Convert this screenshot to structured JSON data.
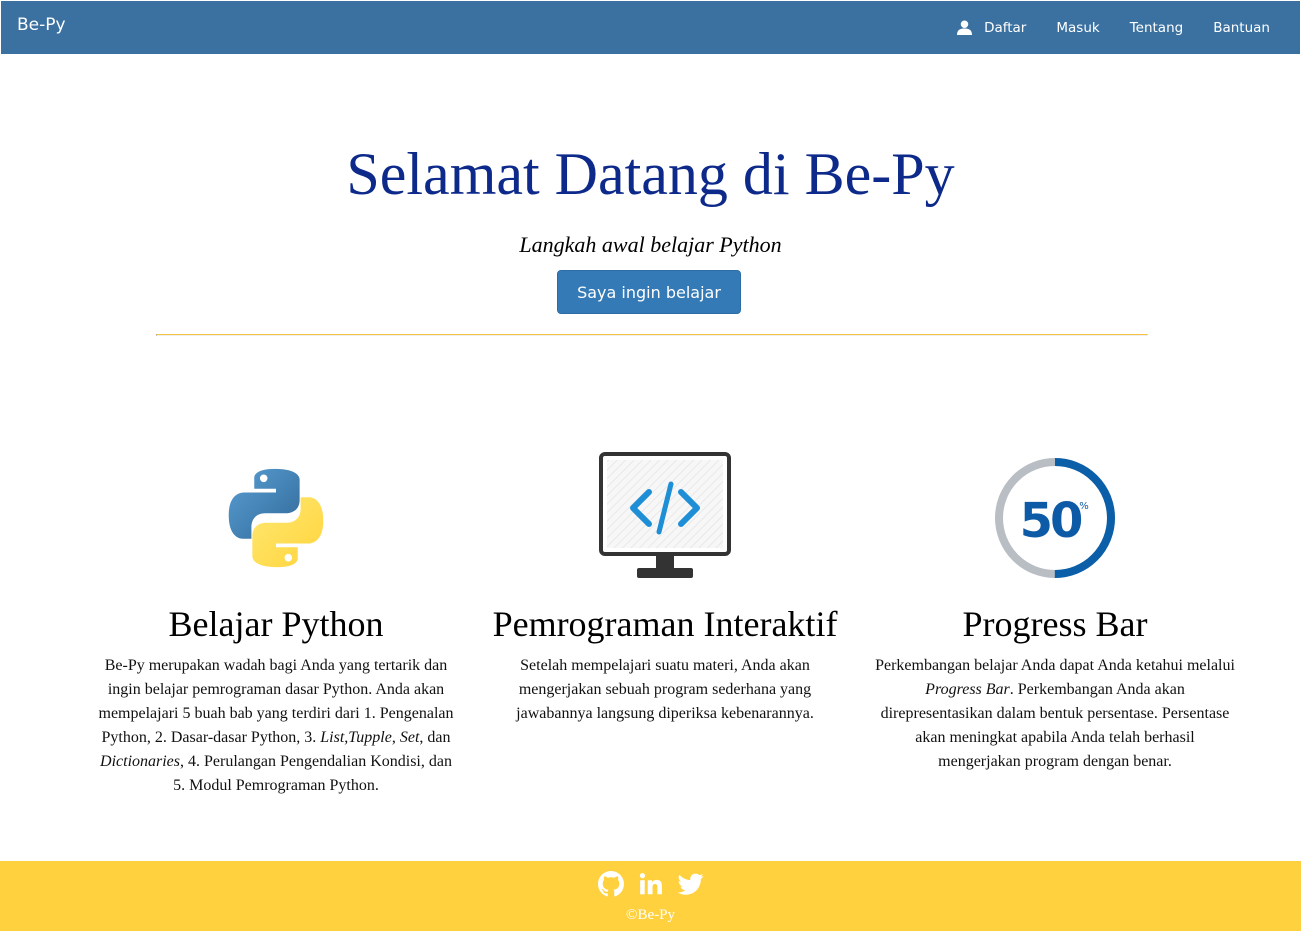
{
  "navbar": {
    "brand": "Be-Py",
    "items": [
      {
        "label": "Daftar",
        "icon": "user-icon"
      },
      {
        "label": "Masuk"
      },
      {
        "label": "Tentang"
      },
      {
        "label": "Bantuan"
      }
    ]
  },
  "hero": {
    "title": "Selamat Datang di Be-Py",
    "subtitle": "Langkah awal belajar Python",
    "cta_label": "Saya ingin belajar"
  },
  "features": [
    {
      "icon": "python-logo-icon",
      "title": "Belajar Python",
      "text_parts": [
        "Be-Py merupakan wadah bagi Anda yang tertarik dan ingin belajar pemrograman dasar Python. Anda akan mempelajari 5 buah bab yang terdiri dari 1. Pengenalan Python, 2. Dasar-dasar Python, 3. ",
        "List",
        ",",
        "Tupple",
        ", ",
        "Set",
        ", dan ",
        "Dictionaries",
        ", 4. Perulangan Pengendalian Kondisi, dan 5. Modul Pemrograman Python."
      ]
    },
    {
      "icon": "monitor-code-icon",
      "title": "Pemrograman Interaktif",
      "text": "Setelah mempelajari suatu materi, Anda akan mengerjakan sebuah program sederhana yang jawabannya langsung diperiksa kebenarannya."
    },
    {
      "icon": "progress-circle-icon",
      "title": "Progress Bar",
      "progress_value": "50",
      "progress_unit": "%",
      "progress_fraction": 0.5,
      "text_parts": [
        "Perkembangan belajar Anda dapat Anda ketahui melalui ",
        "Progress Bar",
        ". Perkembangan Anda akan direpresentasikan dalam bentuk persentase. Persentase akan meningkat apabila Anda telah berhasil mengerjakan program dengan benar."
      ]
    }
  ],
  "footer": {
    "social": [
      "github-icon",
      "linkedin-icon",
      "twitter-icon"
    ],
    "copyright": "©Be-Py"
  },
  "colors": {
    "navbar": "#3a71a1",
    "title": "#0d2a8a",
    "button": "#337ab7",
    "footer": "#ffd13f",
    "rule": "#f5c542"
  }
}
